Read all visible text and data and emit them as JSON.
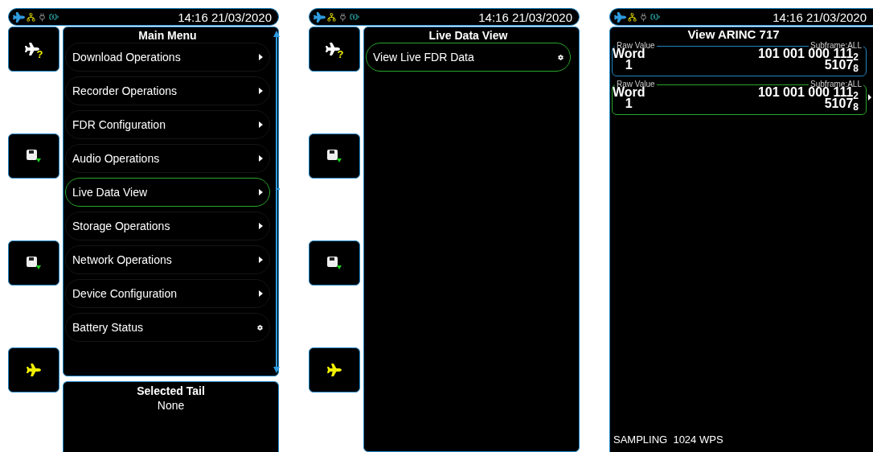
{
  "screens": [
    {
      "status": {
        "time": "14:16 21/03/2020"
      },
      "side_buttons": [
        {
          "kind": "aircraft",
          "badge": "?"
        },
        {
          "kind": "save"
        },
        {
          "kind": "save"
        },
        {
          "kind": "aircraft"
        }
      ],
      "panel": {
        "title": "Main Menu",
        "scrollable": true,
        "items": [
          {
            "label": "Download Operations",
            "kind": "submenu",
            "selected": false
          },
          {
            "label": "Recorder Operations",
            "kind": "submenu",
            "selected": false
          },
          {
            "label": "FDR Configuration",
            "kind": "submenu",
            "selected": false
          },
          {
            "label": "Audio Operations",
            "kind": "submenu",
            "selected": false
          },
          {
            "label": "Live Data View",
            "kind": "submenu",
            "selected": true
          },
          {
            "label": "Storage Operations",
            "kind": "submenu",
            "selected": false
          },
          {
            "label": "Network Operations",
            "kind": "submenu",
            "selected": false
          },
          {
            "label": "Device Configuration",
            "kind": "submenu",
            "selected": false
          },
          {
            "label": "Battery Status",
            "kind": "action",
            "selected": false
          }
        ]
      },
      "footer": {
        "title": "Selected Tail",
        "value": "None"
      }
    },
    {
      "status": {
        "time": "14:16 21/03/2020"
      },
      "side_buttons": [
        {
          "kind": "aircraft",
          "badge": "?"
        },
        {
          "kind": "save"
        },
        {
          "kind": "save"
        },
        {
          "kind": "aircraft"
        }
      ],
      "panel": {
        "title": "Live Data View",
        "scrollable": false,
        "items": [
          {
            "label": "View Live FDR Data",
            "kind": "action",
            "selected": true
          }
        ]
      }
    },
    {
      "status": {
        "time": "14:16 21/03/2020"
      },
      "panel": {
        "title": "View ARINC 717",
        "records": [
          {
            "label": "Raw Value",
            "subframe": "Subframe:ALL",
            "word": "Word",
            "index": "1",
            "binary": "101 001 000 111$_{2}$",
            "octal": "5107$_{8}$",
            "selected": false
          },
          {
            "label": "Raw Value",
            "subframe": "Subframe:ALL",
            "word": "Word",
            "index": "1",
            "binary": "101 001 000 111$_{2}$",
            "octal": "5107$_{8}$",
            "selected": true
          }
        ],
        "status_text": "SAMPLING  1024 WPS"
      }
    }
  ]
}
